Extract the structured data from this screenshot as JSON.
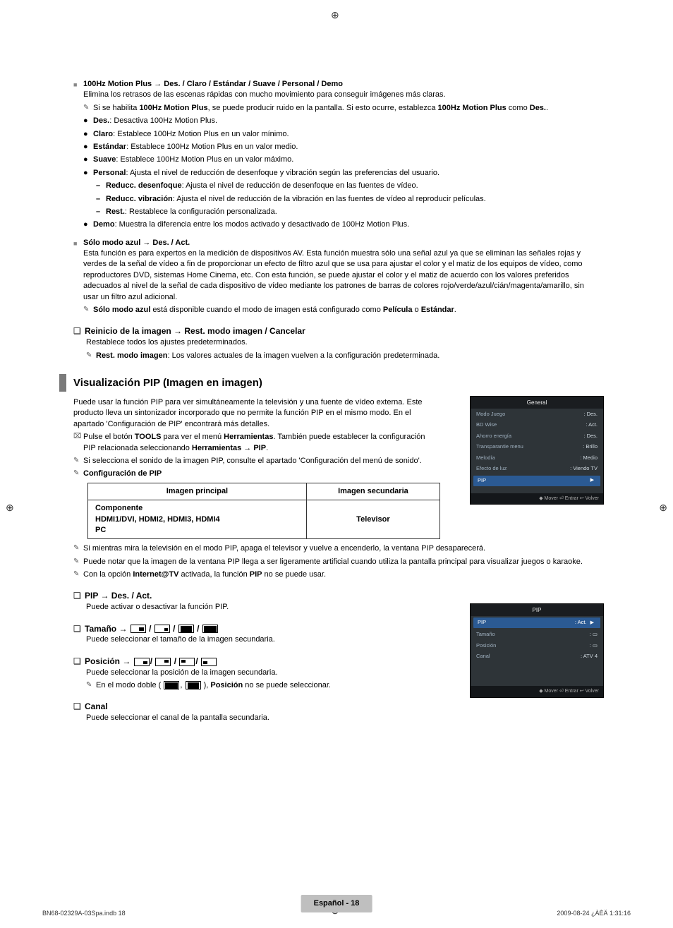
{
  "regmark": "⊕",
  "motionPlus": {
    "title": "100Hz Motion Plus → Des. / Claro / Estándar / Suave / Personal / Demo",
    "desc": "Elimina los retrasos de las escenas rápidas con mucho movimiento para conseguir imágenes más claras.",
    "note1a": "Si se habilita ",
    "note1b": "100Hz Motion Plus",
    "note1c": ", se puede producir ruido en la pantalla. Si esto ocurre, establezca ",
    "note1d": "100Hz Motion Plus",
    "note1e": " como ",
    "note1f": "Des.",
    "note1g": ".",
    "items": {
      "des": {
        "label": "Des.",
        "text": ": Desactiva 100Hz Motion Plus."
      },
      "claro": {
        "label": "Claro",
        "text": ": Establece 100Hz Motion Plus en un valor mínimo."
      },
      "estandar": {
        "label": "Estándar",
        "text": ": Establece 100Hz Motion Plus en un valor medio."
      },
      "suave": {
        "label": "Suave",
        "text": ": Establece 100Hz Motion Plus en un valor máximo."
      },
      "personal": {
        "label": "Personal",
        "text": ": Ajusta el nivel de reducción de desenfoque y vibración según las preferencias del usuario."
      },
      "sub": {
        "desenf": {
          "label": "Reducc. desenfoque",
          "text": ": Ajusta el nivel de reducción de desenfoque en las fuentes de vídeo."
        },
        "vibr": {
          "label": "Reducc. vibración",
          "text": ": Ajusta el nivel de reducción de la vibración en las fuentes de vídeo al reproducir películas."
        },
        "rest": {
          "label": "Rest.",
          "text": ": Restablece la configuración personalizada."
        }
      },
      "demo": {
        "label": "Demo",
        "text": ": Muestra la diferencia entre los modos activado y desactivado de 100Hz Motion Plus."
      }
    }
  },
  "soloAzul": {
    "title": "Sólo modo azul → Des. / Act.",
    "body": "Esta función es para expertos en la medición de dispositivos AV. Esta función muestra sólo una señal azul ya que se eliminan las señales rojas y verdes de la señal de vídeo a fin de proporcionar un efecto de filtro azul que se usa para ajustar el color y el matiz de los equipos de vídeo, como reproductores DVD, sistemas Home Cinema, etc. Con esta función, se puede ajustar el color y el matiz de acuerdo con los valores preferidos adecuados al nivel de la señal de cada dispositivo de vídeo mediante los patrones de barras de colores rojo/verde/azul/cián/magenta/amarillo, sin usar un filtro azul adicional.",
    "note_a": "Sólo modo azul",
    "note_b": " está disponible cuando el modo de imagen está configurado como ",
    "note_c": "Película",
    "note_d": " o ",
    "note_e": "Estándar",
    "note_f": "."
  },
  "reinicio": {
    "head": "Reinicio de la imagen → Rest. modo imagen / Cancelar",
    "line1": "Restablece todos los ajustes predeterminados.",
    "note_a": "Rest. modo imagen",
    "note_b": ": Los valores actuales de la imagen vuelven a la configuración predeterminada."
  },
  "pipSection": {
    "title": "Visualización PIP (Imagen en imagen)",
    "intro": "Puede usar la función PIP para ver simultáneamente la televisión y una fuente de vídeo externa. Este producto lleva un sintonizador incorporado que no permite la función PIP en el mismo modo. En el apartado 'Configuración de PIP' encontrará más detalles.",
    "tool_a": "Pulse el botón ",
    "tool_b": "TOOLS",
    "tool_c": " para ver el menú ",
    "tool_d": "Herramientas",
    "tool_e": ". También puede establecer la configuración PIP relacionada seleccionando ",
    "tool_f": "Herramientas → PIP",
    "tool_g": ".",
    "note_sound": "Si selecciona el sonido de la imagen PIP, consulte el apartado 'Configuración del menú de sonido'.",
    "conf_label": "Configuración de PIP",
    "table": {
      "h1": "Imagen principal",
      "h2": "Imagen secundaria",
      "c1a": "Componente",
      "c1b": "HDMI1/DVI, HDMI2, HDMI3, HDMI4",
      "c1c": "PC",
      "c2": "Televisor"
    },
    "note_off": "Si mientras mira la televisión en el modo PIP, apaga el televisor y vuelve a encenderlo, la ventana PIP desaparecerá.",
    "note_art": "Puede notar que la imagen de la ventana PIP llega a ser ligeramente artificial cuando utiliza la pantalla principal para visualizar juegos o karaoke.",
    "note_itv_a": "Con la opción ",
    "note_itv_b": "Internet@TV",
    "note_itv_c": " activada, la función ",
    "note_itv_d": "PIP",
    "note_itv_e": " no se puede usar.",
    "pip_onoff": {
      "head": "PIP → Des. / Act.",
      "body": "Puede activar o desactivar la función PIP."
    },
    "tamano": {
      "head_pref": "Tamaño → ",
      "body": "Puede seleccionar el tamaño de la imagen secundaria."
    },
    "posicion": {
      "head_pref": "Posición → ",
      "body": "Puede seleccionar la posición de la imagen secundaria.",
      "note_a": "En el modo doble (",
      "note_b": "), ",
      "note_c": "Posición",
      "note_d": " no se puede seleccionar."
    },
    "canal": {
      "head": "Canal",
      "body": "Puede seleccionar el canal de la pantalla secundaria."
    }
  },
  "osd1": {
    "title": "General",
    "rows": [
      {
        "k": "Modo Juego",
        "v": ": Des."
      },
      {
        "k": "BD Wise",
        "v": ": Act."
      },
      {
        "k": "Ahorro energía",
        "v": ": Des."
      },
      {
        "k": "Transparantie menu",
        "v": ": Brillo"
      },
      {
        "k": "Melodía",
        "v": ": Medio"
      },
      {
        "k": "Efecto de luz",
        "v": ": Viendo TV"
      }
    ],
    "hlKey": "PIP",
    "hlArrow": "▶",
    "footer": "◆ Mover   ⏎ Entrar   ↩ Volver"
  },
  "osd2": {
    "title": "PIP",
    "hlKey": "PIP",
    "hlVal": ": Act.",
    "hlArrow": "▶",
    "rows": [
      {
        "k": "Tamaño",
        "v": ": ▭"
      },
      {
        "k": "Posición",
        "v": ": ▭"
      },
      {
        "k": "Canal",
        "v": ": ATV 4"
      }
    ],
    "footer": "◆ Mover   ⏎ Entrar   ↩ Volver"
  },
  "footer": {
    "page": "Español - 18",
    "left": "BN68-02329A-03Spa.indb   18",
    "right": "2009-08-24   ¿ÀÈÄ 1:31:16"
  }
}
